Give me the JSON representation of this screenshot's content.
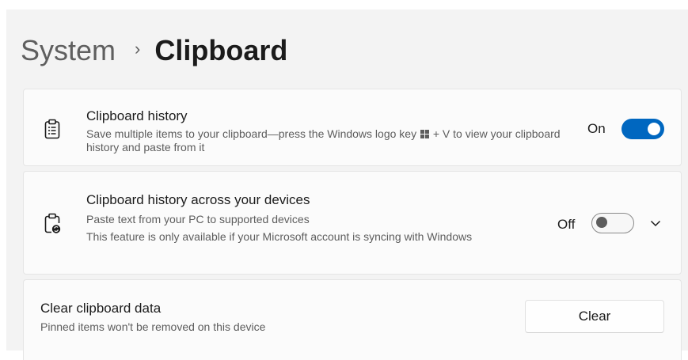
{
  "breadcrumb": {
    "parent": "System",
    "separator": "›",
    "current": "Clipboard"
  },
  "clipboard_history": {
    "title": "Clipboard history",
    "description_before_key": "Save multiple items to your clipboard—press the Windows logo key",
    "description_after_key": "+ V to view your clipboard history and paste from it",
    "state_label": "On",
    "toggle_on": true,
    "icon": "clipboard-list-icon"
  },
  "history_across_devices": {
    "title": "Clipboard history across your devices",
    "description_line1": "Paste text from your PC to supported devices",
    "description_line2": "This feature is only available if your Microsoft account is syncing with Windows",
    "state_label": "Off",
    "toggle_on": false,
    "icon": "clipboard-sync-icon",
    "expand_icon": "chevron-down-icon"
  },
  "clear_data": {
    "title": "Clear clipboard data",
    "description": "Pinned items won't be removed on this device",
    "button_label": "Clear"
  },
  "colors": {
    "accent": "#0067c0",
    "card_background": "#fbfbfb",
    "page_background": "#f3f3f3"
  }
}
